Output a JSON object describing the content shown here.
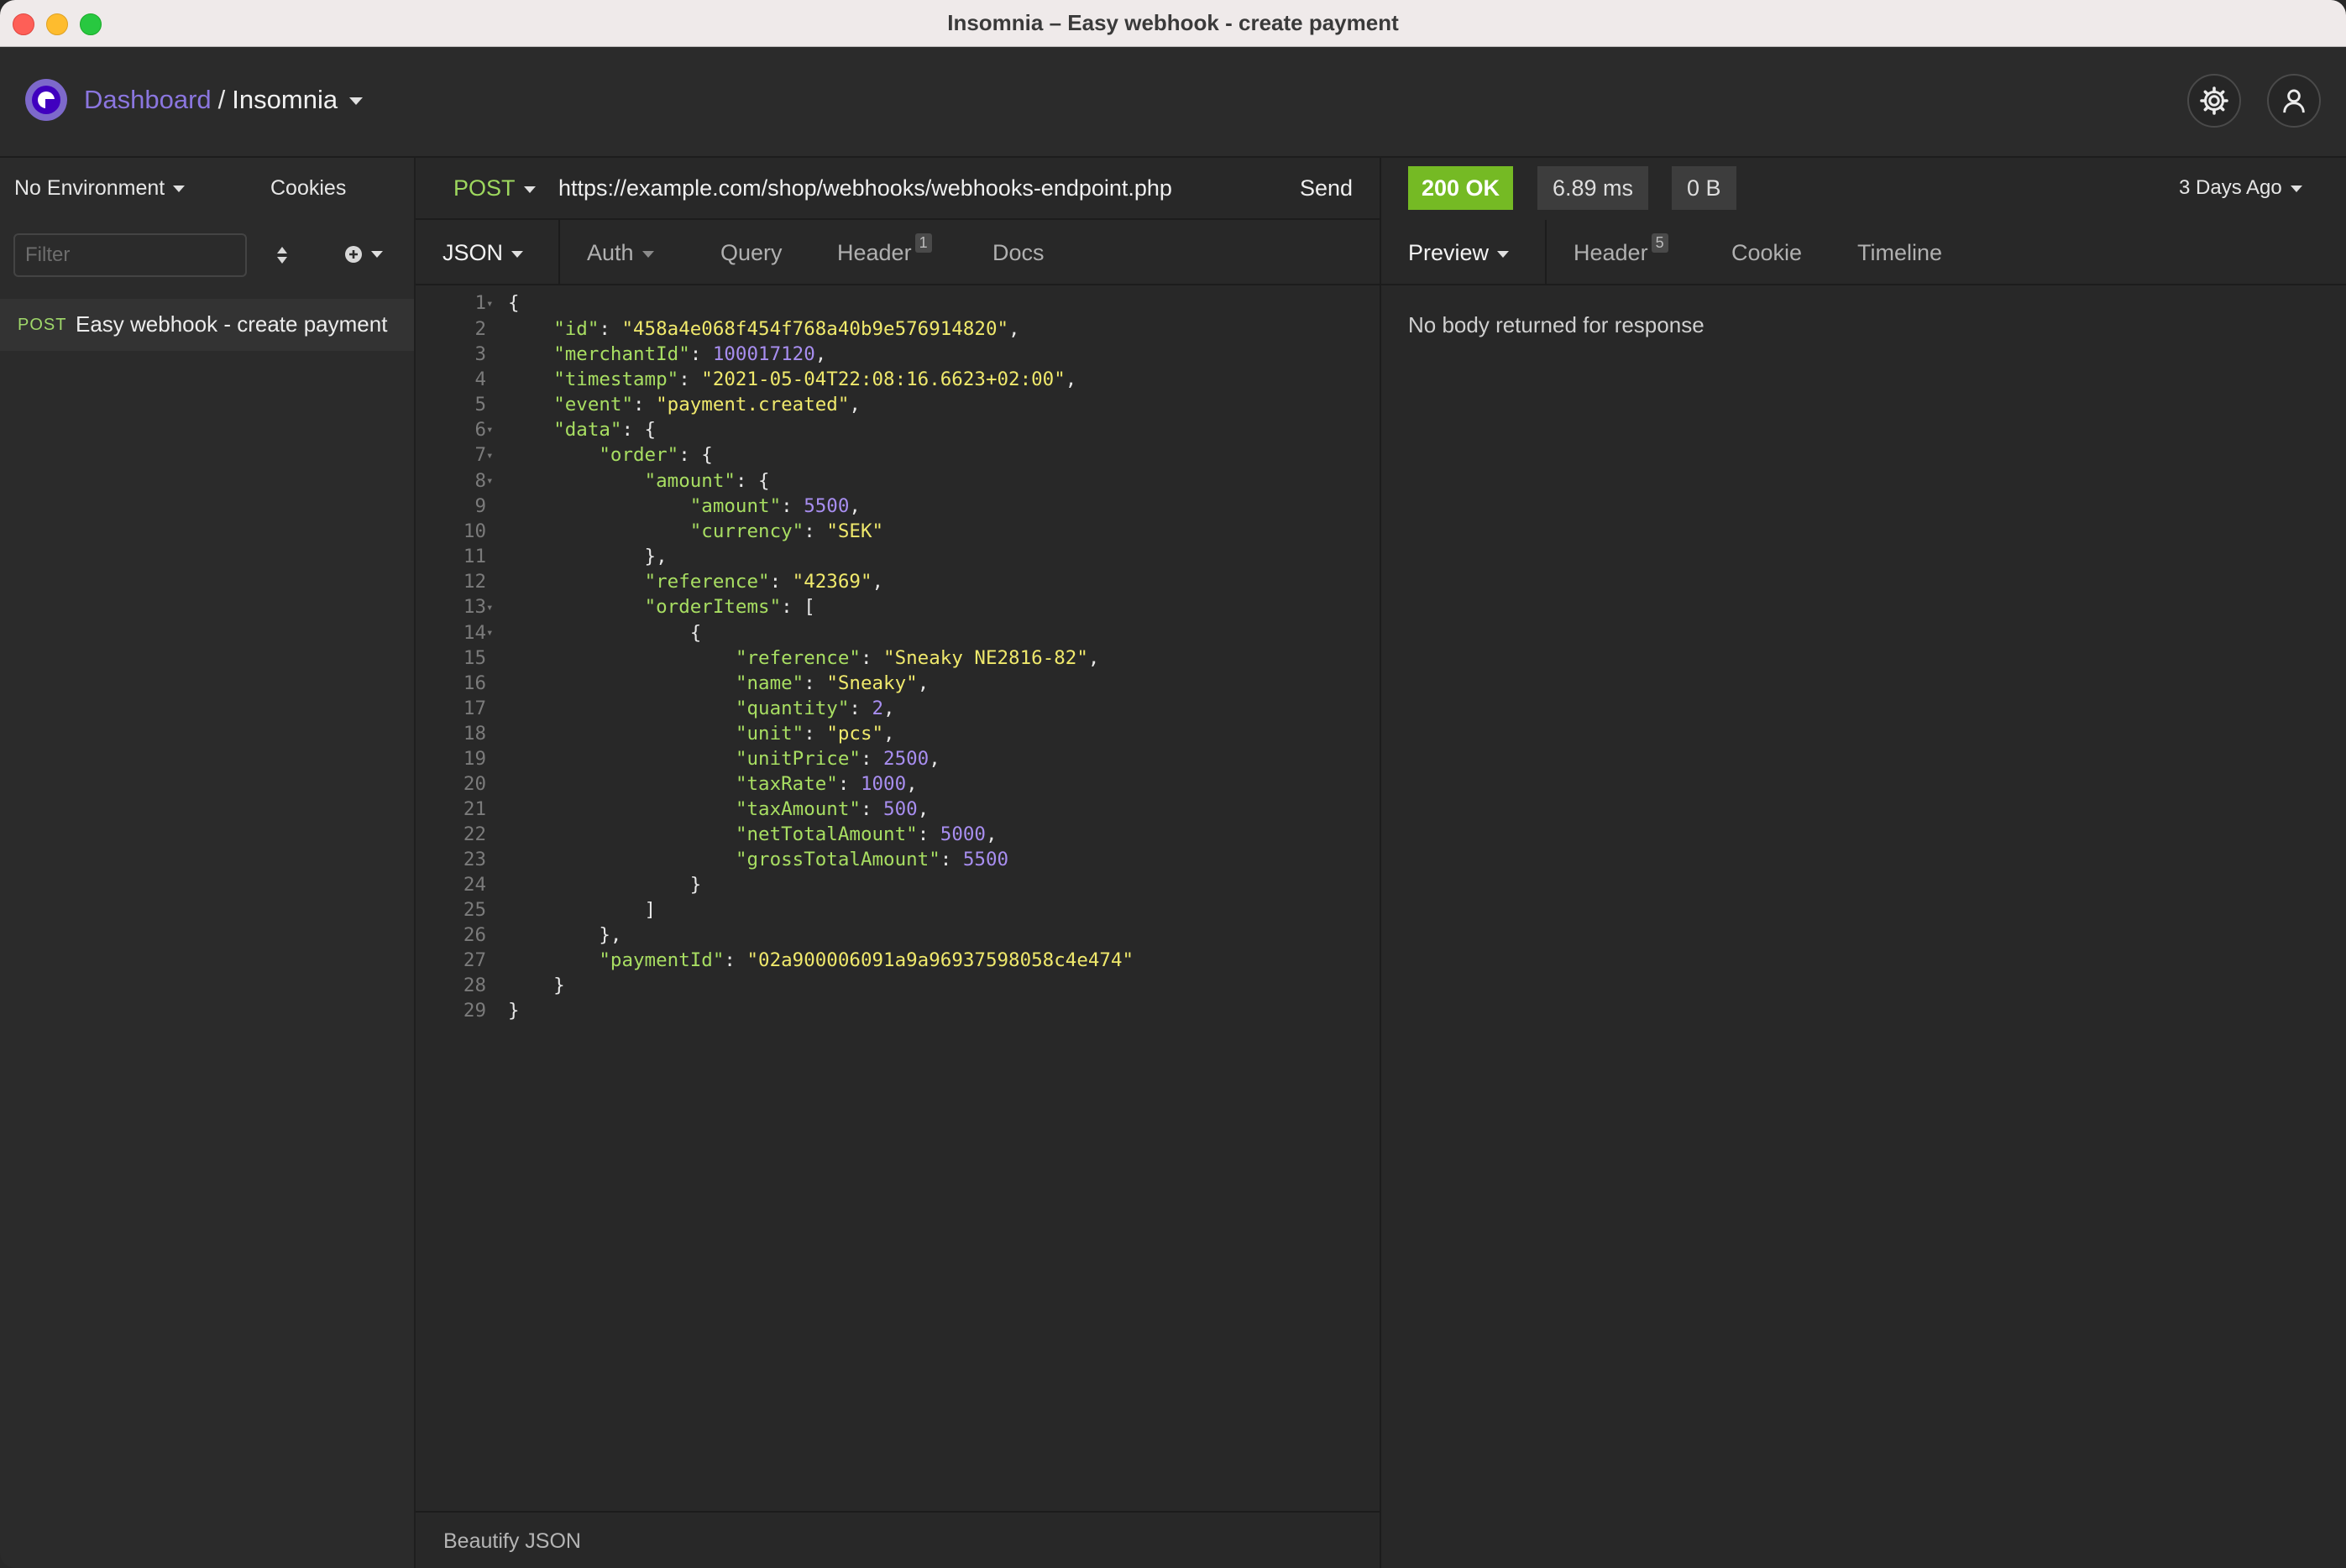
{
  "window": {
    "title": "Insomnia – Easy webhook - create payment"
  },
  "header": {
    "dashboard_label": "Dashboard",
    "separator": "/",
    "workspace_label": "Insomnia"
  },
  "sidebar": {
    "environment_label": "No Environment",
    "cookies_label": "Cookies",
    "filter_placeholder": "Filter",
    "requests": [
      {
        "method": "POST",
        "name": "Easy webhook - create payment"
      }
    ]
  },
  "request": {
    "method": "POST",
    "url": "https://example.com/shop/webhooks/webhooks-endpoint.php",
    "send_label": "Send",
    "tabs": {
      "body": "JSON",
      "auth": "Auth",
      "query": "Query",
      "header": "Header",
      "header_count": "1",
      "docs": "Docs"
    },
    "footer_action": "Beautify JSON"
  },
  "response": {
    "status": "200 OK",
    "time": "6.89 ms",
    "size": "0 B",
    "history": "3 Days Ago",
    "tabs": {
      "preview": "Preview",
      "header": "Header",
      "header_count": "5",
      "cookie": "Cookie",
      "timeline": "Timeline"
    },
    "empty_message": "No body returned for response"
  },
  "colors": {
    "accent": "#7d69cb",
    "status_ok": "#75ba24",
    "method_post": "#9ed85e",
    "json_key": "#a8de62",
    "json_string": "#f0e96c",
    "json_number": "#a88ef0"
  },
  "icons": {
    "logo": "insomnia-logo",
    "settings": "gear-icon",
    "account": "user-icon",
    "sort": "sort-icon",
    "add": "plus-circle-icon"
  },
  "editor": {
    "lines": [
      {
        "n": "1",
        "fold": true,
        "code": [
          [
            "p",
            "{"
          ]
        ]
      },
      {
        "n": "2",
        "code": [
          [
            "p",
            "    "
          ],
          [
            "k",
            "\"id\""
          ],
          [
            "p",
            ": "
          ],
          [
            "s",
            "\"458a4e068f454f768a40b9e576914820\""
          ],
          [
            "p",
            ","
          ]
        ]
      },
      {
        "n": "3",
        "code": [
          [
            "p",
            "    "
          ],
          [
            "k",
            "\"merchantId\""
          ],
          [
            "p",
            ": "
          ],
          [
            "n",
            "100017120"
          ],
          [
            "p",
            ","
          ]
        ]
      },
      {
        "n": "4",
        "code": [
          [
            "p",
            "    "
          ],
          [
            "k",
            "\"timestamp\""
          ],
          [
            "p",
            ": "
          ],
          [
            "s",
            "\"2021-05-04T22:08:16.6623+02:00\""
          ],
          [
            "p",
            ","
          ]
        ]
      },
      {
        "n": "5",
        "code": [
          [
            "p",
            "    "
          ],
          [
            "k",
            "\"event\""
          ],
          [
            "p",
            ": "
          ],
          [
            "s",
            "\"payment.created\""
          ],
          [
            "p",
            ","
          ]
        ]
      },
      {
        "n": "6",
        "fold": true,
        "code": [
          [
            "p",
            "    "
          ],
          [
            "k",
            "\"data\""
          ],
          [
            "p",
            ": {"
          ]
        ]
      },
      {
        "n": "7",
        "fold": true,
        "code": [
          [
            "p",
            "        "
          ],
          [
            "k",
            "\"order\""
          ],
          [
            "p",
            ": {"
          ]
        ]
      },
      {
        "n": "8",
        "fold": true,
        "code": [
          [
            "p",
            "            "
          ],
          [
            "k",
            "\"amount\""
          ],
          [
            "p",
            ": {"
          ]
        ]
      },
      {
        "n": "9",
        "code": [
          [
            "p",
            "                "
          ],
          [
            "k",
            "\"amount\""
          ],
          [
            "p",
            ": "
          ],
          [
            "n",
            "5500"
          ],
          [
            "p",
            ","
          ]
        ]
      },
      {
        "n": "10",
        "code": [
          [
            "p",
            "                "
          ],
          [
            "k",
            "\"currency\""
          ],
          [
            "p",
            ": "
          ],
          [
            "s",
            "\"SEK\""
          ]
        ]
      },
      {
        "n": "11",
        "code": [
          [
            "p",
            "            },"
          ]
        ]
      },
      {
        "n": "12",
        "code": [
          [
            "p",
            "            "
          ],
          [
            "k",
            "\"reference\""
          ],
          [
            "p",
            ": "
          ],
          [
            "s",
            "\"42369\""
          ],
          [
            "p",
            ","
          ]
        ]
      },
      {
        "n": "13",
        "fold": true,
        "code": [
          [
            "p",
            "            "
          ],
          [
            "k",
            "\"orderItems\""
          ],
          [
            "p",
            ": ["
          ]
        ]
      },
      {
        "n": "14",
        "fold": true,
        "code": [
          [
            "p",
            "                {"
          ]
        ]
      },
      {
        "n": "15",
        "code": [
          [
            "p",
            "                    "
          ],
          [
            "k",
            "\"reference\""
          ],
          [
            "p",
            ": "
          ],
          [
            "s",
            "\"Sneaky NE2816-82\""
          ],
          [
            "p",
            ","
          ]
        ]
      },
      {
        "n": "16",
        "code": [
          [
            "p",
            "                    "
          ],
          [
            "k",
            "\"name\""
          ],
          [
            "p",
            ": "
          ],
          [
            "s",
            "\"Sneaky\""
          ],
          [
            "p",
            ","
          ]
        ]
      },
      {
        "n": "17",
        "code": [
          [
            "p",
            "                    "
          ],
          [
            "k",
            "\"quantity\""
          ],
          [
            "p",
            ": "
          ],
          [
            "n",
            "2"
          ],
          [
            "p",
            ","
          ]
        ]
      },
      {
        "n": "18",
        "code": [
          [
            "p",
            "                    "
          ],
          [
            "k",
            "\"unit\""
          ],
          [
            "p",
            ": "
          ],
          [
            "s",
            "\"pcs\""
          ],
          [
            "p",
            ","
          ]
        ]
      },
      {
        "n": "19",
        "code": [
          [
            "p",
            "                    "
          ],
          [
            "k",
            "\"unitPrice\""
          ],
          [
            "p",
            ": "
          ],
          [
            "n",
            "2500"
          ],
          [
            "p",
            ","
          ]
        ]
      },
      {
        "n": "20",
        "code": [
          [
            "p",
            "                    "
          ],
          [
            "k",
            "\"taxRate\""
          ],
          [
            "p",
            ": "
          ],
          [
            "n",
            "1000"
          ],
          [
            "p",
            ","
          ]
        ]
      },
      {
        "n": "21",
        "code": [
          [
            "p",
            "                    "
          ],
          [
            "k",
            "\"taxAmount\""
          ],
          [
            "p",
            ": "
          ],
          [
            "n",
            "500"
          ],
          [
            "p",
            ","
          ]
        ]
      },
      {
        "n": "22",
        "code": [
          [
            "p",
            "                    "
          ],
          [
            "k",
            "\"netTotalAmount\""
          ],
          [
            "p",
            ": "
          ],
          [
            "n",
            "5000"
          ],
          [
            "p",
            ","
          ]
        ]
      },
      {
        "n": "23",
        "code": [
          [
            "p",
            "                    "
          ],
          [
            "k",
            "\"grossTotalAmount\""
          ],
          [
            "p",
            ": "
          ],
          [
            "n",
            "5500"
          ]
        ]
      },
      {
        "n": "24",
        "code": [
          [
            "p",
            "                }"
          ]
        ]
      },
      {
        "n": "25",
        "code": [
          [
            "p",
            "            ]"
          ]
        ]
      },
      {
        "n": "26",
        "code": [
          [
            "p",
            "        },"
          ]
        ]
      },
      {
        "n": "27",
        "code": [
          [
            "p",
            "        "
          ],
          [
            "k",
            "\"paymentId\""
          ],
          [
            "p",
            ": "
          ],
          [
            "s",
            "\"02a900006091a9a96937598058c4e474\""
          ]
        ]
      },
      {
        "n": "28",
        "code": [
          [
            "p",
            "    }"
          ]
        ]
      },
      {
        "n": "29",
        "code": [
          [
            "p",
            "}"
          ]
        ]
      }
    ]
  }
}
